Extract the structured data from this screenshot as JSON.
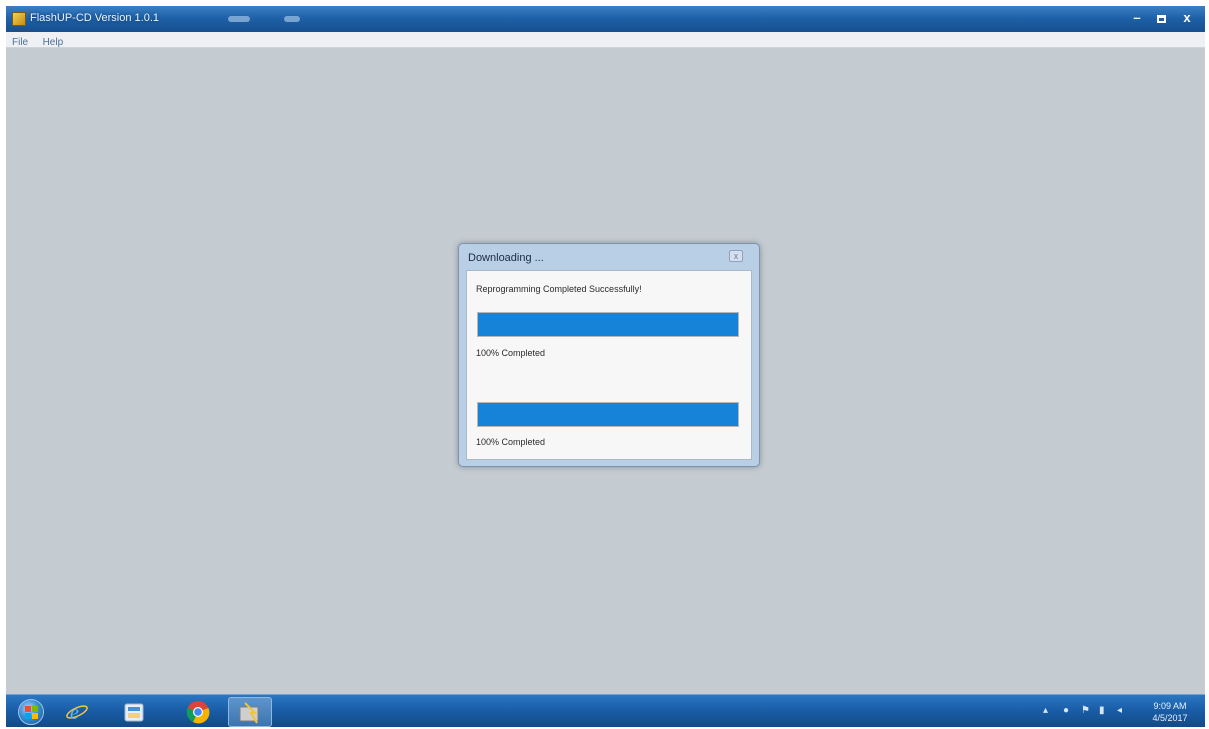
{
  "window": {
    "title": "FlashUP-CD Version 1.0.1",
    "minimize_label": "–",
    "close_label": "x"
  },
  "menu": {
    "items": [
      "File",
      "Help"
    ]
  },
  "dialog": {
    "title": "Downloading ...",
    "close_label": "x",
    "message": "Reprogramming Completed Successfully!",
    "progress": [
      {
        "percent": 100,
        "label": "100% Completed"
      },
      {
        "percent": 100,
        "label": "100% Completed"
      }
    ]
  },
  "taskbar": {
    "icons": [
      "start-orb",
      "internet-explorer-icon",
      "file-explorer-icon",
      "chrome-icon",
      "flashup-app-icon"
    ]
  },
  "tray": {
    "time": "9:09 AM",
    "date": "4/5/2017"
  },
  "colors": {
    "desktop_background": "#c4cbd1",
    "progress_fill": "#1683d8",
    "titlebar": "#1d5fa6",
    "taskbar": "#1a5ea8"
  }
}
